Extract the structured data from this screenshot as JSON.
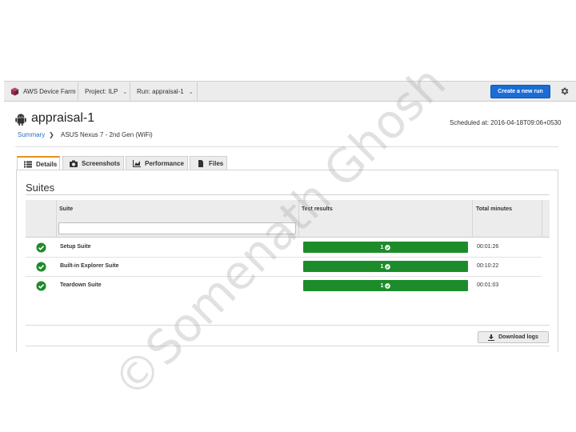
{
  "topnav": {
    "brand": "AWS Device Farm",
    "project_label": "Project: ILP",
    "run_label": "Run: appraisal-1",
    "create_button": "Create a new run",
    "gear_icon": "gear-icon",
    "logo_icon": "device-farm-cube-icon"
  },
  "header": {
    "title": "appraisal-1",
    "platform_icon": "android-icon",
    "breadcrumb_link": "Summary",
    "breadcrumb_current": "ASUS Nexus 7 - 2nd Gen (WiFi)",
    "scheduled": "Scheduled at: 2016-04-18T09:06+0530"
  },
  "tabs": [
    {
      "label": "Details",
      "icon": "list-icon",
      "active": true
    },
    {
      "label": "Screenshots",
      "icon": "camera-icon",
      "active": false
    },
    {
      "label": "Performance",
      "icon": "chart-icon",
      "active": false
    },
    {
      "label": "Files",
      "icon": "file-icon",
      "active": false
    }
  ],
  "suites": {
    "title": "Suites",
    "columns": {
      "suite": "Suite",
      "results": "Test results",
      "minutes": "Total minutes"
    },
    "filter_placeholder": "",
    "rows": [
      {
        "name": "Setup Suite",
        "passed": "1",
        "minutes": "00:01:26",
        "status_icon": "check-circle-icon"
      },
      {
        "name": "Built-in Explorer Suite",
        "passed": "1",
        "minutes": "00:10:22",
        "status_icon": "check-circle-icon"
      },
      {
        "name": "Teardown Suite",
        "passed": "1",
        "minutes": "00:01:03",
        "status_icon": "check-circle-icon"
      }
    ]
  },
  "download_button": "Download logs",
  "watermark": "©Somenath Ghosh",
  "colors": {
    "accent_blue": "#1a6dd6",
    "pass_green": "#1c8c2a",
    "active_tab_orange": "#e8901c",
    "link_blue": "#2a6fbf"
  }
}
